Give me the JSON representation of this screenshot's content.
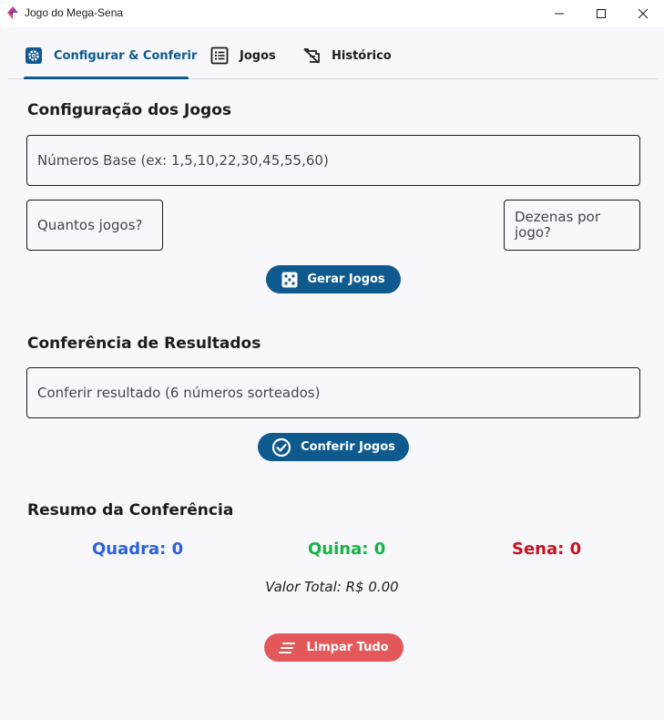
{
  "window": {
    "title": "Jogo do Mega-Sena",
    "icons": [
      "app-icon",
      "minimize-icon",
      "maximize-icon",
      "close-icon"
    ]
  },
  "tabs": [
    {
      "label": "Configurar & Conferir",
      "icon": "gear-icon",
      "active": true
    },
    {
      "label": "Jogos",
      "icon": "list-icon",
      "active": false
    },
    {
      "label": "Histórico",
      "icon": "history-icon",
      "active": false
    }
  ],
  "config": {
    "title": "Configuração dos Jogos",
    "base_numbers": {
      "value": "",
      "placeholder": "Números Base (ex: 1,5,10,22,30,45,55,60)"
    },
    "num_games": {
      "value": "",
      "placeholder": "Quantos jogos?"
    },
    "numbers_per_game": {
      "value": "",
      "placeholder_line1": "Dezenas por",
      "placeholder_line2": "jogo?"
    },
    "generate_button": {
      "label": "Gerar Jogos",
      "icon": "dice-icon"
    }
  },
  "check": {
    "title": "Conferência de Resultados",
    "result_input": {
      "value": "",
      "placeholder": "Conferir resultado (6 números sorteados)"
    },
    "check_button": {
      "label": "Conferir Jogos",
      "icon": "check-circle-icon"
    }
  },
  "summary": {
    "title": "Resumo da Conferência",
    "quadra": "Quadra: 0",
    "quina": "Quina: 0",
    "sena": "Sena: 0",
    "total": "Valor Total: R$ 0.00",
    "clear_button": {
      "label": "Limpar Tudo",
      "icon": "clear-all-icon"
    }
  },
  "colors": {
    "primary": "#0e5a8f",
    "danger_button": "#e35959",
    "quadra": "#2a62d8",
    "quina": "#12b543",
    "sena": "#c8121c",
    "background": "#f8f7fc"
  }
}
